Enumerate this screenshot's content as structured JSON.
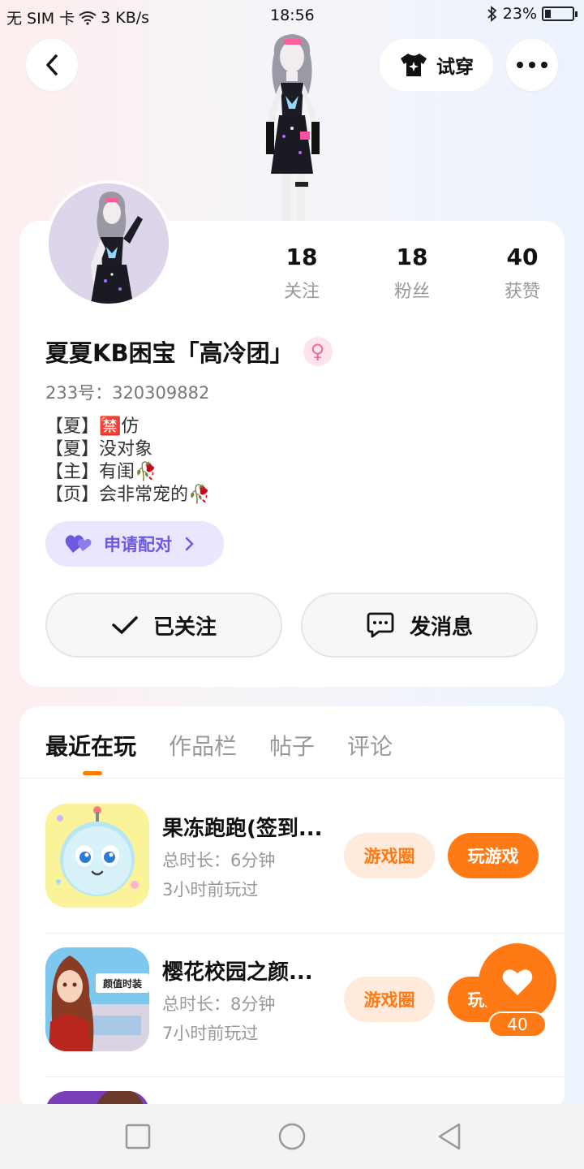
{
  "status_bar": {
    "carrier": "无 SIM 卡",
    "speed": "3 KB/s",
    "time": "18:56",
    "battery": "23%",
    "battery_level": 0.23
  },
  "header": {
    "tryon_label": "试穿"
  },
  "profile": {
    "stats": [
      {
        "value": "18",
        "label": "关注"
      },
      {
        "value": "18",
        "label": "粉丝"
      },
      {
        "value": "40",
        "label": "获赞"
      }
    ],
    "name": "夏夏KB困宝「高冷团」",
    "gender_symbol": "♀",
    "uid": "233号：320309882",
    "bio_lines": [
      "【夏】🈲仿",
      "【夏】没对象",
      "【主】有闺🥀",
      "【页】会非常宠的🥀"
    ],
    "pair_label": "申请配对",
    "follow_label": "已关注",
    "message_label": "发消息"
  },
  "tabs": [
    {
      "label": "最近在玩",
      "active": true
    },
    {
      "label": "作品栏",
      "active": false
    },
    {
      "label": "帖子",
      "active": false
    },
    {
      "label": "评论",
      "active": false
    }
  ],
  "games": [
    {
      "title": "果冻跑跑(签到...",
      "duration": "总时长：6分钟",
      "last_played": "3小时前玩过",
      "circle_label": "游戏圈",
      "play_label": "玩游戏"
    },
    {
      "title": "樱花校园之颜...",
      "duration": "总时长：8分钟",
      "last_played": "7小时前玩过",
      "circle_label": "游戏圈",
      "play_label": "玩游戏",
      "icon_text": "颜值时装"
    }
  ],
  "like": {
    "count": "40"
  },
  "colors": {
    "accent": "#ff7a14",
    "pair": "#6a5ae0",
    "gender": "#f06a9e"
  }
}
